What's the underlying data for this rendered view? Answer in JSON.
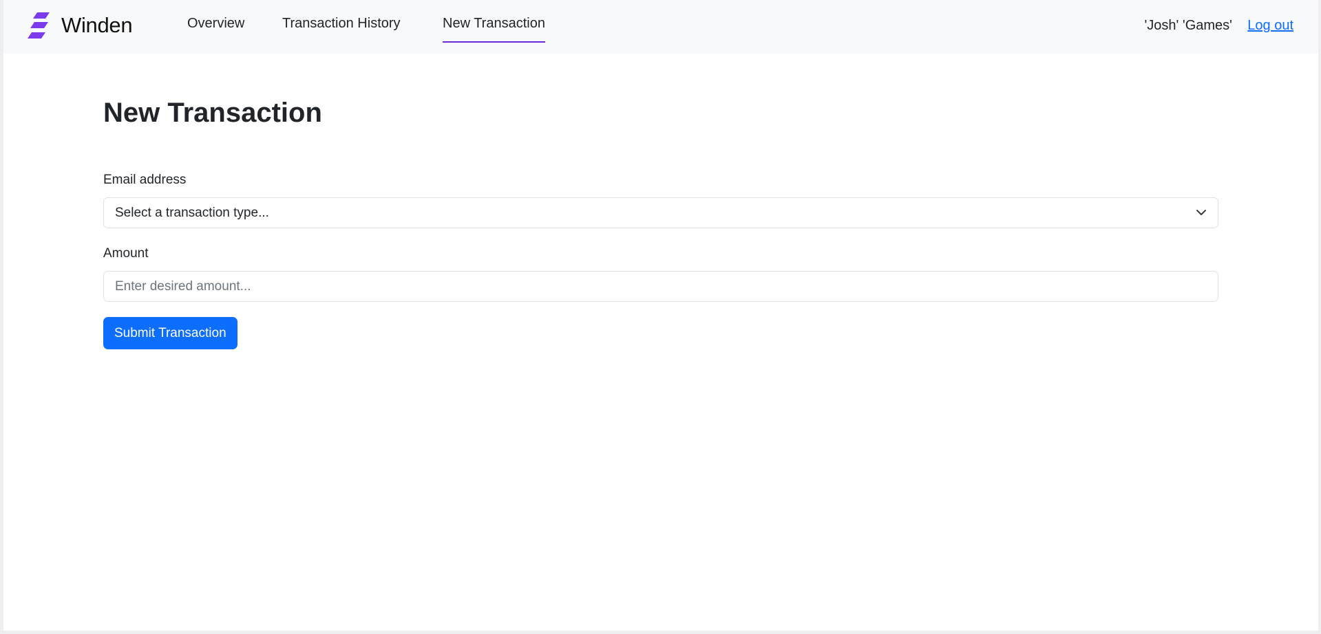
{
  "colors": {
    "accent": "#6d28d9",
    "primary_button": "#0d6efd",
    "link": "#0d6efd",
    "navbar_bg": "#f8f9fa"
  },
  "header": {
    "brand": {
      "name": "Winden",
      "icon": "winden-logo-icon"
    },
    "nav": [
      {
        "label": "Overview",
        "active": false
      },
      {
        "label": "Transaction History",
        "active": false
      },
      {
        "label": "New Transaction",
        "active": true
      }
    ],
    "user_name": "'Josh' 'Games'",
    "logout_label": "Log out"
  },
  "main": {
    "title": "New Transaction",
    "form": {
      "email_label": "Email address",
      "type_select": {
        "selected": "Select a transaction type...",
        "icon": "chevron-down-icon"
      },
      "amount_label": "Amount",
      "amount_input": {
        "value": "",
        "placeholder": "Enter desired amount..."
      },
      "submit_label": "Submit Transaction"
    }
  }
}
